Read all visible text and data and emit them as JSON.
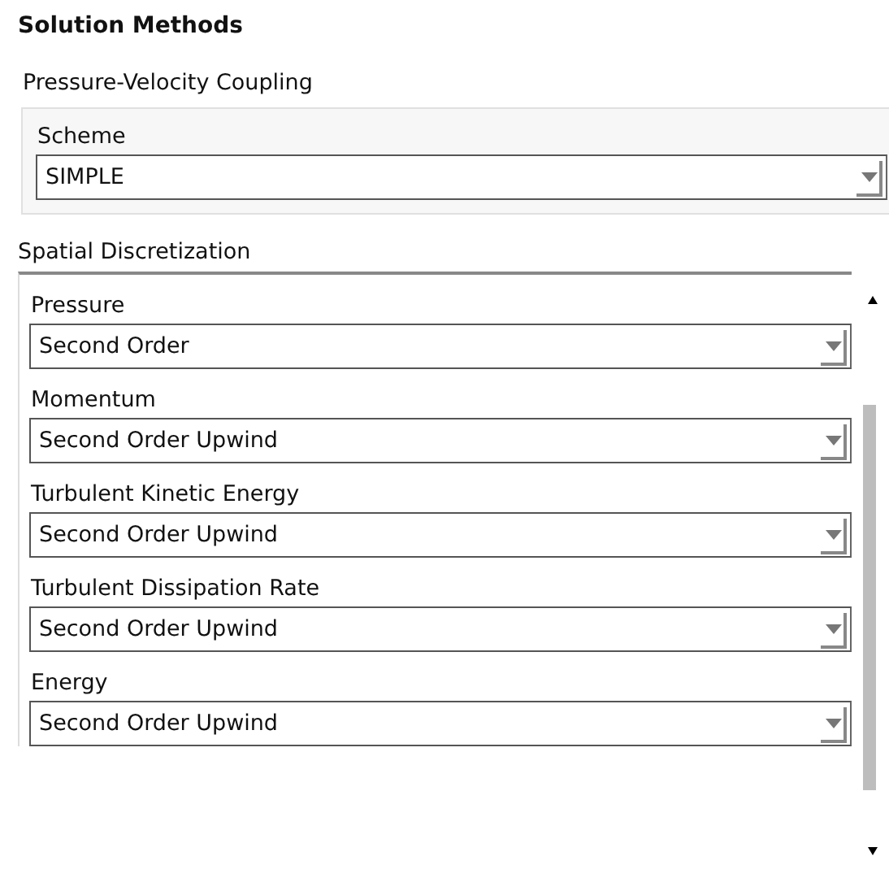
{
  "title": "Solution Methods",
  "coupling": {
    "label": "Pressure-Velocity Coupling",
    "fields": [
      {
        "label": "Scheme",
        "value": "SIMPLE"
      }
    ]
  },
  "discretization": {
    "label": "Spatial Discretization",
    "fields": [
      {
        "label": "Pressure",
        "value": "Second Order"
      },
      {
        "label": "Momentum",
        "value": "Second Order Upwind"
      },
      {
        "label": "Turbulent Kinetic Energy",
        "value": "Second Order Upwind"
      },
      {
        "label": "Turbulent Dissipation Rate",
        "value": "Second Order Upwind"
      },
      {
        "label": "Energy",
        "value": "Second Order Upwind"
      }
    ]
  }
}
